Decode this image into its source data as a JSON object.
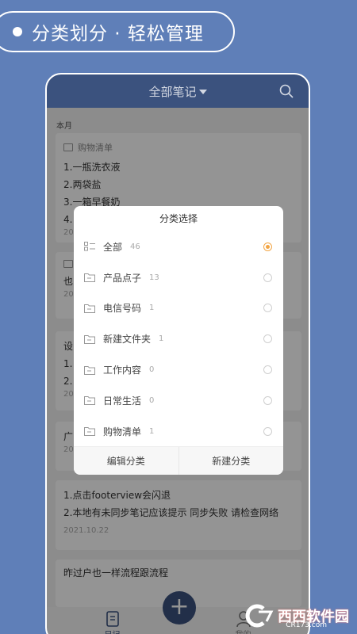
{
  "promo": {
    "text": "分类划分 · 轻松管理"
  },
  "header": {
    "title": "全部笔记"
  },
  "list": {
    "section_label": "本月",
    "notes": [
      {
        "folder": "购物清单",
        "lines": [
          "1.一瓶洗衣液",
          "2.两袋盐",
          "3.一箱早餐奶",
          "4."
        ],
        "date": "20"
      },
      {
        "folder": "",
        "lines": [
          "也"
        ],
        "date": "20"
      },
      {
        "folder": "",
        "lines": [
          "设",
          "1.",
          "2."
        ],
        "date": "20"
      },
      {
        "folder": "",
        "lines": [
          "广"
        ],
        "date": "20"
      },
      {
        "folder": "",
        "lines": [
          "1.点击footerview会闪退",
          "2.本地有未同步笔记应该提示 同步失败 请检查网络"
        ],
        "date": "2021.10.22"
      },
      {
        "folder": "",
        "lines": [
          "昨过户也一样流程跟流程"
        ],
        "date": ""
      }
    ]
  },
  "fab": {
    "label": "+"
  },
  "nav": {
    "notes_label": "日记",
    "me_label": "我的"
  },
  "dialog": {
    "title": "分类选择",
    "categories": [
      {
        "label": "全部",
        "count": "46",
        "selected": true,
        "icon": "list-icon"
      },
      {
        "label": "产品点子",
        "count": "13",
        "selected": false,
        "icon": "folder-icon"
      },
      {
        "label": "电信号码",
        "count": "1",
        "selected": false,
        "icon": "folder-icon"
      },
      {
        "label": "新建文件夹",
        "count": "1",
        "selected": false,
        "icon": "folder-icon"
      },
      {
        "label": "工作内容",
        "count": "0",
        "selected": false,
        "icon": "folder-icon"
      },
      {
        "label": "日常生活",
        "count": "0",
        "selected": false,
        "icon": "folder-icon"
      },
      {
        "label": "购物清单",
        "count": "1",
        "selected": false,
        "icon": "folder-icon"
      }
    ],
    "edit_label": "编辑分类",
    "new_label": "新建分类"
  },
  "watermark": {
    "brand": "西西软件园",
    "sub": "CR173.com"
  },
  "colors": {
    "background": "#5f7fb8",
    "header": "#3b527e",
    "accent": "#f2a544"
  }
}
